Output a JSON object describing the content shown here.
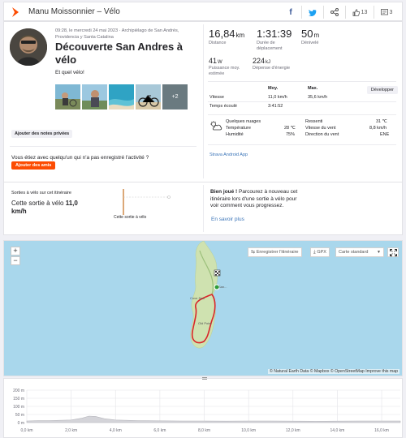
{
  "header": {
    "title": "Manu Moissonnier – Vélo",
    "kudos_count": "13",
    "comments_count": "3"
  },
  "summary": {
    "meta": "09:28, le mercredi 24 mai 2023 · Archipiélago de San Andrés, Providencia y Santa Catalina",
    "title": "Découverte San Andres à vélo",
    "description": "Et quel vélo!",
    "photos_more": "+2",
    "add_notes_label": "Ajouter des notes privées",
    "question": "Vous étiez avec quelqu'un qui n'a pas enregistré l'activité ?",
    "add_them_label": "Ajouter des amis"
  },
  "stats": {
    "distance": {
      "value": "16,84",
      "unit": "km",
      "label": "Distance"
    },
    "moving_time": {
      "value": "1:31:39",
      "label": "Durée de déplacement"
    },
    "elevation": {
      "value": "50",
      "unit": "m",
      "label": "Dénivelé"
    },
    "power": {
      "value": "41",
      "unit": "W",
      "label": "Puissance moy. estimée"
    },
    "energy": {
      "value": "224",
      "unit": "kJ",
      "label": "Dépense d'énergie"
    }
  },
  "details": {
    "develop_label": "Développer",
    "col_avg": "Moy.",
    "col_max": "Max.",
    "speed_label": "Vitesse",
    "speed_avg": "11,0 km/h",
    "speed_max": "35,6 km/h",
    "elapsed_label": "Temps écoulé",
    "elapsed_value": "3:41:52"
  },
  "weather": {
    "condition": "Quelques nuages",
    "temp_label": "Température",
    "temp_value": "28 ℃",
    "humidity_label": "Humidité",
    "humidity_value": "75%",
    "feels_label": "Ressenti",
    "feels_value": "31 ℃",
    "wind_speed_label": "Vitesse du vent",
    "wind_speed_value": "8,8 km/h",
    "wind_dir_label": "Direction du vent",
    "wind_dir_value": "ENE"
  },
  "device": "Strava Android App",
  "segment": {
    "label": "Sorties à vélo sur cet itinéraire",
    "text_prefix": "Cette sortie à vélo",
    "text_value": "11,0",
    "text_unit": "km/h",
    "chart_label": "Cette sortie à vélo"
  },
  "bravo": {
    "bold": "Bien joué !",
    "text": " Parcourez à nouveau cet itinéraire lors d'une sortie à vélo pour voir comment vous progressez.",
    "link": "En savoir plus"
  },
  "map": {
    "zoom_in": "+",
    "zoom_out": "−",
    "save_route": "Enregistrer l'itinéraire",
    "gpx": "GPX",
    "map_style": "Carte standard",
    "attribution": "© Natural Earth Data © Mapbox © OpenStreetMap Improve this map",
    "place_1": "San...",
    "place_2": "Cove Sea",
    "place_3": "Old Point"
  },
  "chart_data": {
    "type": "area",
    "title": "",
    "xlabel": "",
    "ylabel": "",
    "x_ticks": [
      "0,0 km",
      "2,0 km",
      "4,0 km",
      "6,0 km",
      "8,0 km",
      "10,0 km",
      "12,0 km",
      "14,0 km",
      "16,0 km"
    ],
    "y_ticks": [
      "0 m",
      "50 m",
      "100 m",
      "150 m",
      "200 m"
    ],
    "xlim": [
      0,
      16.84
    ],
    "ylim": [
      0,
      200
    ],
    "x": [
      0,
      0.5,
      1.0,
      1.5,
      2.0,
      2.5,
      2.8,
      3.1,
      3.5,
      4.0,
      4.5,
      5.0,
      6.0,
      7.0,
      8.0,
      9.0,
      10.0,
      11.0,
      12.0,
      13.0,
      14.0,
      15.0,
      16.0,
      16.84
    ],
    "y": [
      10,
      12,
      12,
      14,
      16,
      28,
      40,
      38,
      24,
      16,
      14,
      12,
      11,
      10,
      10,
      9,
      10,
      10,
      9,
      8,
      9,
      10,
      10,
      10
    ]
  }
}
